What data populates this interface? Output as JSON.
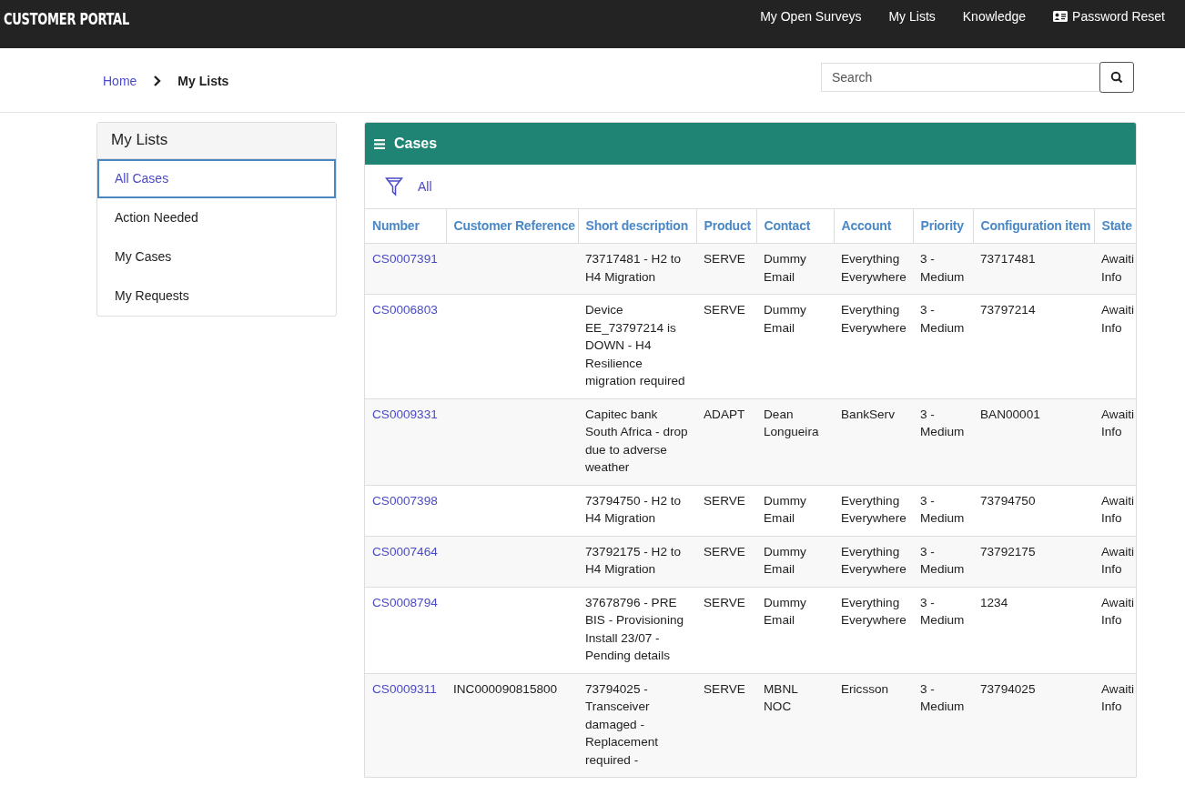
{
  "navbar": {
    "brand": "CUSTOMER PORTAL",
    "links": [
      {
        "label": "My Open Surveys",
        "icon": false
      },
      {
        "label": "My Lists",
        "icon": false
      },
      {
        "label": "Knowledge",
        "icon": false
      },
      {
        "label": "Password Reset",
        "icon": true
      }
    ]
  },
  "breadcrumb": [
    {
      "label": "Home",
      "current": false
    },
    {
      "label": "My Lists",
      "current": true
    }
  ],
  "search": {
    "placeholder": "Search"
  },
  "sidebar": {
    "title": "My Lists",
    "items": [
      {
        "label": "All Cases",
        "selected": true
      },
      {
        "label": "Action Needed",
        "selected": false
      },
      {
        "label": "My Cases",
        "selected": false
      },
      {
        "label": "My Requests",
        "selected": false
      }
    ]
  },
  "panel": {
    "title": "Cases",
    "filter": "All"
  },
  "table": {
    "columns": [
      "Number",
      "Customer Reference",
      "Short description",
      "Product",
      "Contact",
      "Account",
      "Priority",
      "Configuration item",
      "State"
    ],
    "rows": [
      [
        "CS0007391",
        "",
        "73717481 - H2 to H4 Migration",
        "SERVE",
        "Dummy Email",
        "Everything Everywhere",
        "3 - Medium",
        "73717481",
        "Awaiti Info"
      ],
      [
        "CS0006803",
        "",
        "Device EE_73797214 is DOWN - H4 Resilience migration required",
        "SERVE",
        "Dummy Email",
        "Everything Everywhere",
        "3 - Medium",
        "73797214",
        "Awaiti Info"
      ],
      [
        "CS0009331",
        "",
        "Capitec bank South Africa - drop due to adverse weather",
        "ADAPT",
        "Dean Longueira",
        "BankServ",
        "3 - Medium",
        "BAN00001",
        "Awaiti Info"
      ],
      [
        "CS0007398",
        "",
        "73794750 - H2 to H4 Migration",
        "SERVE",
        "Dummy Email",
        "Everything Everywhere",
        "3 - Medium",
        "73794750",
        "Awaiti Info"
      ],
      [
        "CS0007464",
        "",
        "73792175 - H2 to H4 Migration",
        "SERVE",
        "Dummy Email",
        "Everything Everywhere",
        "3 - Medium",
        "73792175",
        "Awaiti Info"
      ],
      [
        "CS0008794",
        "",
        "37678796 - PRE BIS - Provisioning Install 23/07 - Pending details",
        "SERVE",
        "Dummy Email",
        "Everything Everywhere",
        "3 - Medium",
        "1234",
        "Awaiti Info"
      ],
      [
        "CS0009311",
        "INC000090815800",
        "73794025 - Transceiver damaged - Replacement required -",
        "SERVE",
        "MBNL NOC",
        "Ericsson",
        "3 - Medium",
        "73794025",
        "Awaiti Info"
      ]
    ]
  }
}
